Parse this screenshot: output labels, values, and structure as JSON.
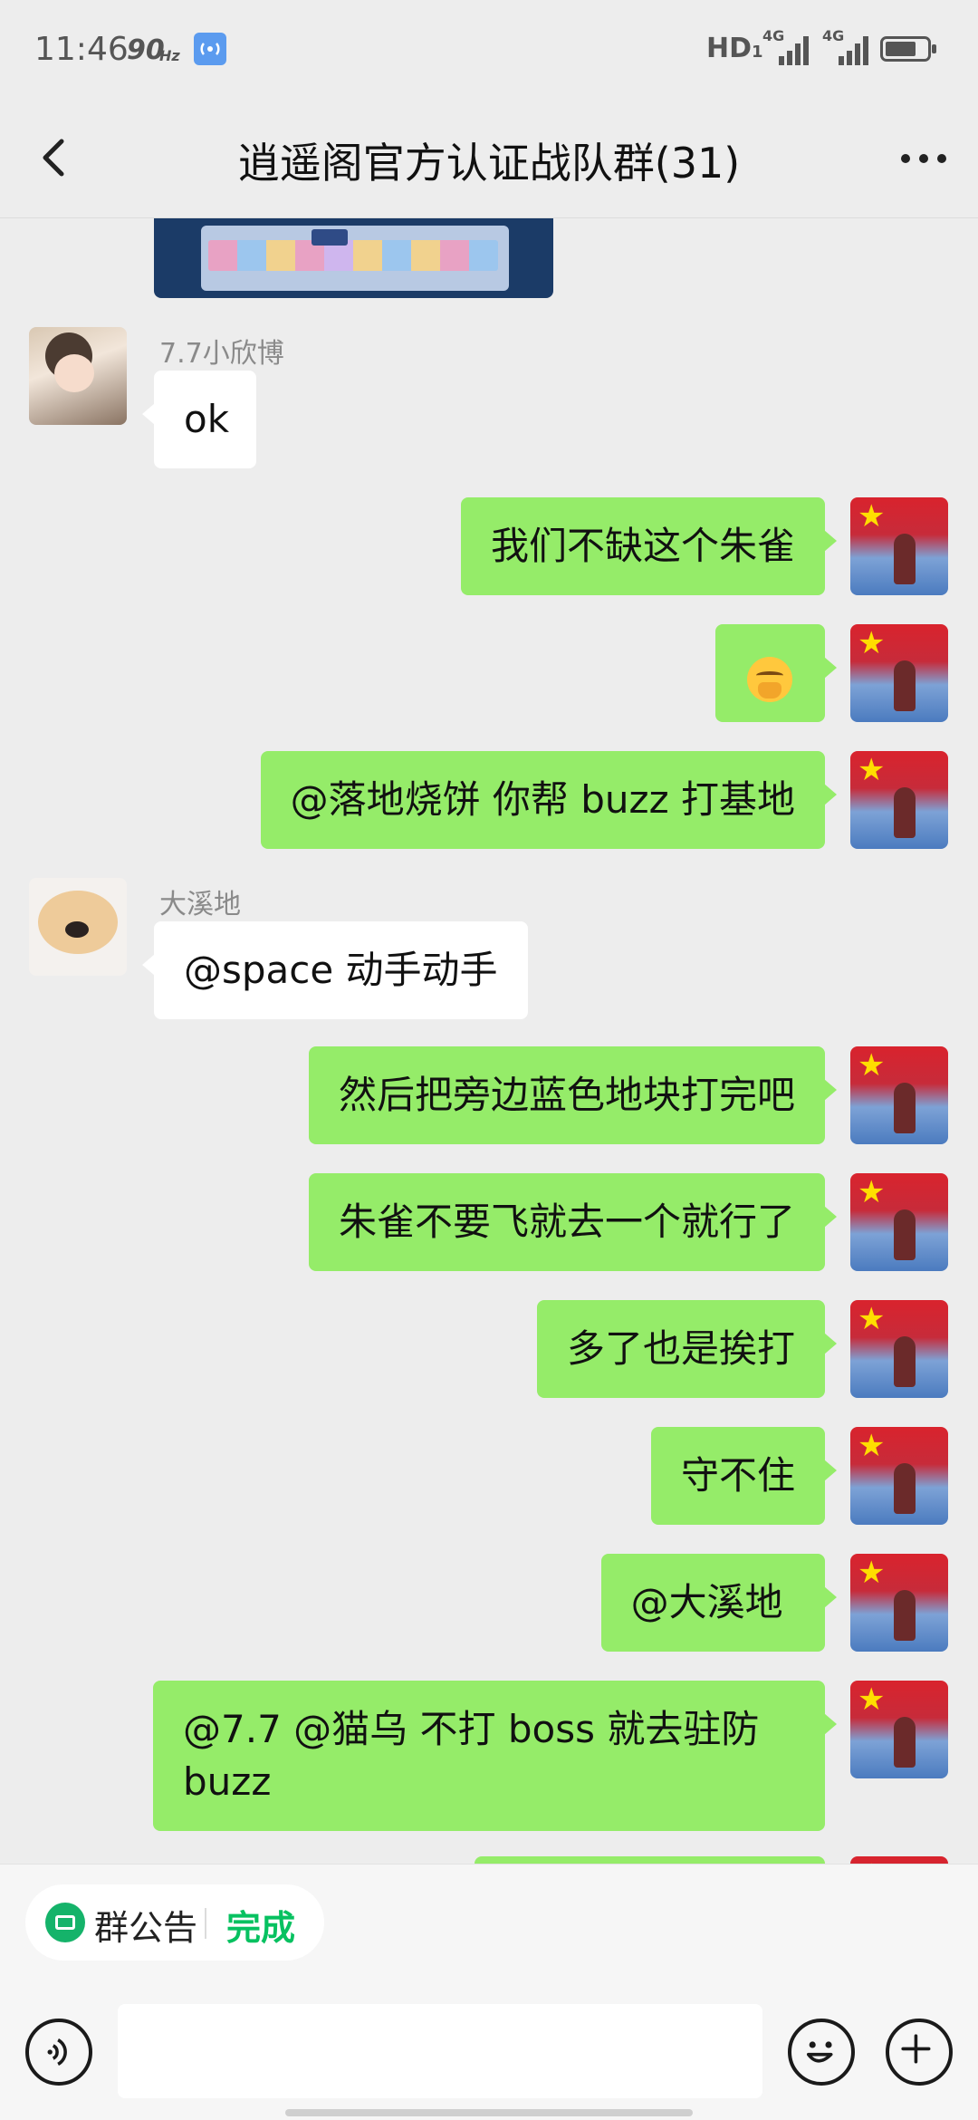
{
  "status_bar": {
    "time": "11:46",
    "refresh_rate": "90",
    "refresh_unit": "Hz",
    "hd_label": "HD",
    "hd_sub": "1",
    "network_1": "4G",
    "network_2": "4G",
    "battery_level": 0.75,
    "icons": [
      "hotspot-icon",
      "signal-icon",
      "battery-icon"
    ]
  },
  "header": {
    "title": "逍遥阁官方认证战队群(31)",
    "back_icon": "chevron-left-icon",
    "more_icon": "more-dots-icon"
  },
  "messages": [
    {
      "side": "left",
      "sender": "7.7小欣博",
      "text": "ok"
    },
    {
      "side": "right",
      "text": "我们不缺这个朱雀"
    },
    {
      "side": "right",
      "emoji": "smirk-face-emoji"
    },
    {
      "side": "right",
      "text": "@落地烧饼  你帮 buzz 打基地"
    },
    {
      "side": "left",
      "sender": "大溪地",
      "text": "@space  动手动手"
    },
    {
      "side": "right",
      "text": "然后把旁边蓝色地块打完吧"
    },
    {
      "side": "right",
      "text": "朱雀不要飞就去一个就行了"
    },
    {
      "side": "right",
      "text": "多了也是挨打"
    },
    {
      "side": "right",
      "text": "守不住"
    },
    {
      "side": "right",
      "text": "@大溪地 "
    },
    {
      "side": "right",
      "text": "@7.7 @猫乌  不打 boss 就去驻防 buzz"
    }
  ],
  "announcement": {
    "label": "群公告",
    "action": "完成",
    "icon": "announcement-icon"
  },
  "input_bar": {
    "placeholder": "",
    "voice_icon": "voice-icon",
    "emoji_icon": "emoji-icon",
    "plus_icon": "plus-icon"
  },
  "colors": {
    "background": "#ededed",
    "self_bubble": "#95ec69",
    "other_bubble": "#ffffff",
    "accent": "#07c160"
  }
}
